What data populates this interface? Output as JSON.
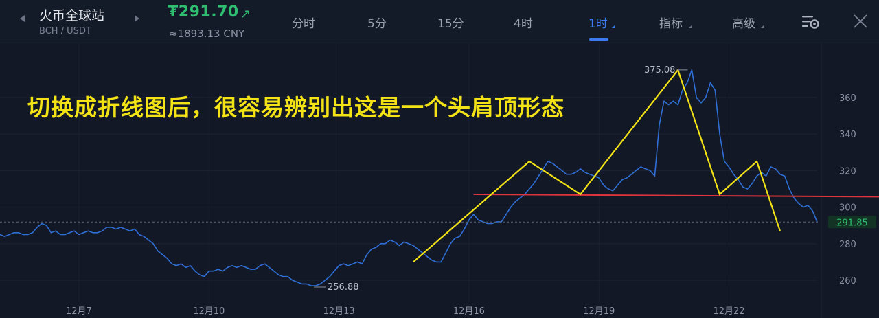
{
  "header": {
    "exchange_name": "火币全球站",
    "pair": "BCH / USDT",
    "price": "₮291.70",
    "price_arrow": "↗",
    "price_cny": "≈1893.13 CNY",
    "tabs": [
      {
        "label": "分时",
        "active": false
      },
      {
        "label": "5分",
        "active": false
      },
      {
        "label": "15分",
        "active": false
      },
      {
        "label": "4时",
        "active": false
      },
      {
        "label": "1时",
        "active": true
      },
      {
        "label": "指标",
        "active": false
      },
      {
        "label": "高级",
        "active": false
      }
    ],
    "icons": [
      "chevron-left-icon",
      "chevron-right-icon",
      "chart-settings-icon",
      "close-icon"
    ]
  },
  "annotation_text": "切换成折线图后，很容易辨别出这是一个头肩顶形态",
  "colors": {
    "background": "#121826",
    "price_line": "#2f6fd6",
    "pattern_line": "#f2e216",
    "neckline": "#e0343c",
    "positive": "#2fbf71",
    "accent": "#3c7cf0"
  },
  "chart_data": {
    "type": "line",
    "title": "",
    "xlabel": "",
    "ylabel": "",
    "ylim": [
      248,
      390
    ],
    "yticks": [
      260,
      280,
      300,
      320,
      340,
      360
    ],
    "x_tick_labels": [
      "12月7",
      "12月10",
      "12月13",
      "12月16",
      "12月19",
      "12月22"
    ],
    "x_tick_index": [
      17,
      45,
      73,
      101,
      129,
      157
    ],
    "grid": true,
    "series": [
      {
        "values": [
          285,
          284,
          285,
          286,
          286,
          285,
          285,
          286,
          289,
          291,
          290,
          286,
          287,
          285,
          285,
          286,
          287,
          285,
          286,
          287,
          286,
          286,
          287,
          289,
          289,
          288,
          289,
          288,
          287,
          288,
          285,
          284,
          282,
          280,
          276,
          274,
          272,
          269,
          268,
          269,
          267,
          268,
          265,
          263,
          262,
          265,
          265,
          266,
          265,
          267,
          268,
          267,
          268,
          267,
          266,
          266,
          268,
          269,
          267,
          265,
          263,
          262,
          262,
          260,
          259,
          258,
          258,
          257,
          257,
          258,
          260,
          262,
          265,
          268,
          269,
          268,
          269,
          270,
          269,
          274,
          277,
          278,
          280,
          280,
          282,
          281,
          279,
          281,
          280,
          279,
          277,
          275,
          273,
          271,
          270,
          270,
          275,
          280,
          283,
          284,
          288,
          293,
          296,
          293,
          292,
          291,
          291,
          292,
          292,
          296,
          300,
          303,
          305,
          307,
          310,
          313,
          317,
          321,
          325,
          324,
          322,
          320,
          318,
          318,
          319,
          321,
          319,
          318,
          317,
          316,
          312,
          310,
          309,
          312,
          315,
          316,
          318,
          320,
          322,
          321,
          320,
          317,
          345,
          358,
          356,
          358,
          356,
          364,
          368,
          375,
          360,
          357,
          360,
          368,
          364,
          340,
          325,
          322,
          318,
          315,
          311,
          310,
          313,
          317,
          319,
          317,
          322,
          321,
          318,
          317,
          310,
          305,
          302,
          300,
          301,
          298,
          291.85
        ],
        "color": "#2f6fd6"
      }
    ],
    "annotations": {
      "max_label": "375.08",
      "min_label": "256.88",
      "current_price_label": "291.85",
      "current_price": 291.85,
      "neckline_points": [
        [
          102,
          307
        ],
        [
          182,
          305
        ]
      ],
      "pattern_points": [
        [
          89,
          270
        ],
        [
          114,
          325
        ],
        [
          125,
          307
        ],
        [
          146,
          375
        ],
        [
          155,
          307
        ],
        [
          163,
          325
        ],
        [
          168,
          287
        ]
      ]
    }
  }
}
